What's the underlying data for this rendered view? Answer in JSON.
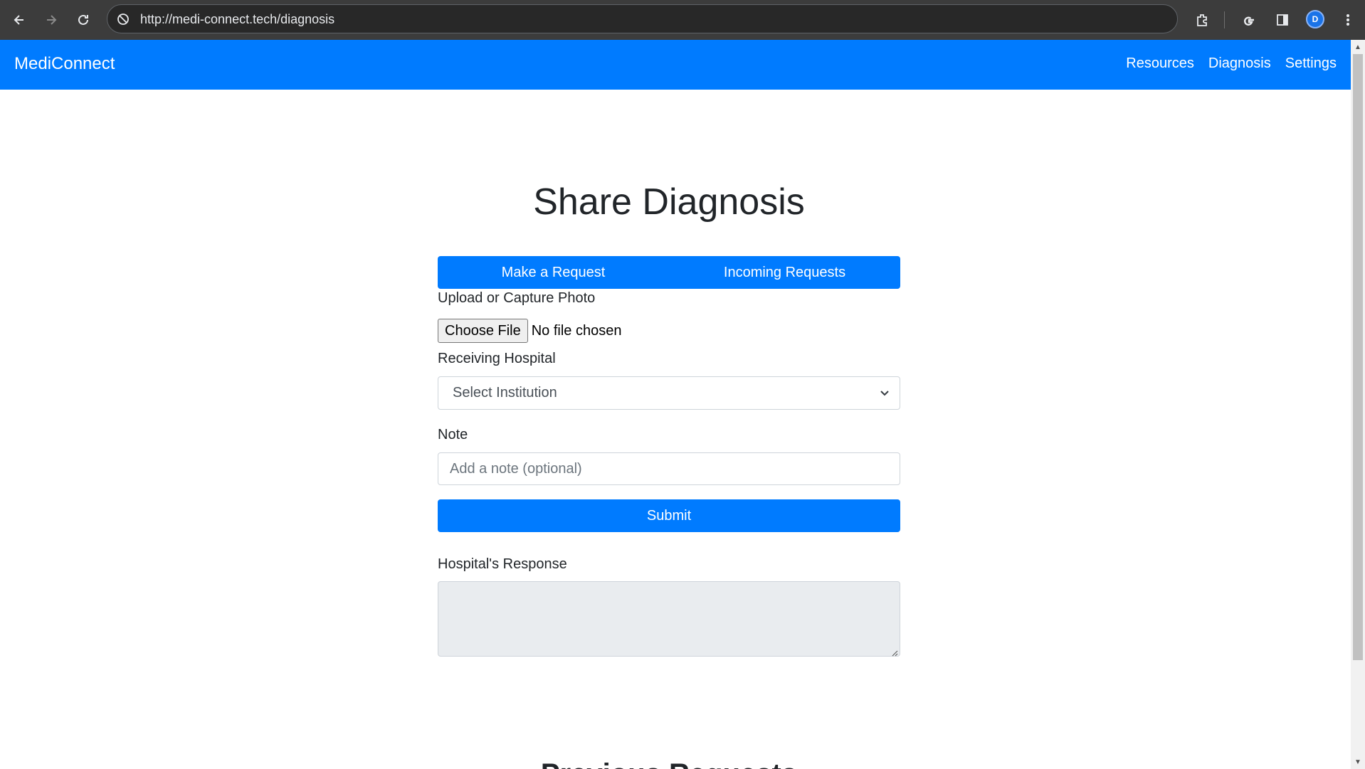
{
  "browser": {
    "url": "http://medi-connect.tech/diagnosis",
    "profile_initial": "D"
  },
  "navbar": {
    "brand": "MediConnect",
    "links": [
      "Resources",
      "Diagnosis",
      "Settings"
    ]
  },
  "main": {
    "title": "Share Diagnosis",
    "tabs": [
      "Make a Request",
      "Incoming Requests"
    ],
    "photo_label": "Upload or Capture Photo",
    "file_button": "Choose File",
    "file_status": "No file chosen",
    "hospital_label": "Receiving Hospital",
    "hospital_select_value": "Select Institution",
    "note_label": "Note",
    "note_placeholder": "Add a note (optional)",
    "submit_label": "Submit",
    "response_label": "Hospital's Response",
    "previous_title": "Previous Requests"
  },
  "colors": {
    "primary": "#007bff",
    "chrome_bg": "#3c3c3c",
    "readonly_bg": "#e9ecef"
  }
}
